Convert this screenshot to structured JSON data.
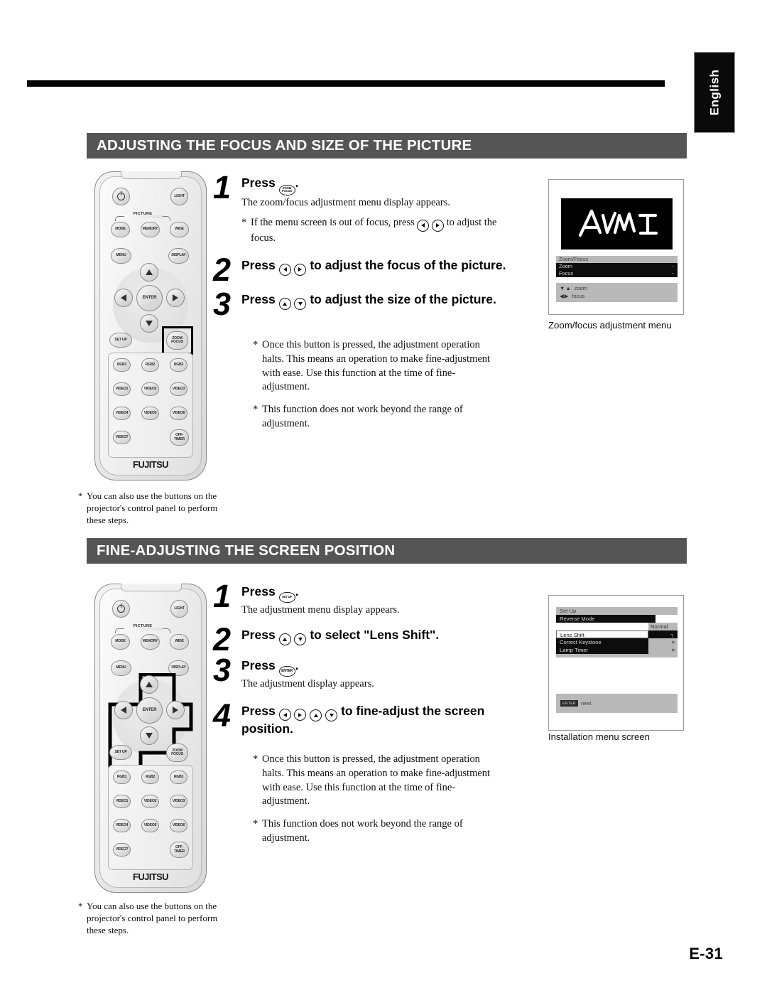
{
  "page": {
    "language_tab": "English",
    "page_number": "E-31"
  },
  "sections": [
    {
      "id": "focus-size",
      "title": "ADJUSTING THE FOCUS AND SIZE OF THE PICTURE",
      "steps": [
        {
          "num": "1",
          "head_before": "Press",
          "head_after": ".",
          "icon": "zoom-focus-key",
          "sub": "The zoom/focus adjustment menu display appears.",
          "note": "If the menu screen is out of focus, press ◀ ▶ to adjust the focus.",
          "note_before": "If the menu screen is out of focus, press",
          "note_after": "to adjust the focus."
        },
        {
          "num": "2",
          "head_before": "Press",
          "head_after": "to adjust the focus of the picture.",
          "icons": [
            "left-arrow-key",
            "right-arrow-key"
          ]
        },
        {
          "num": "3",
          "head_before": "Press",
          "head_after": "to adjust the size of the picture.",
          "icons": [
            "up-arrow-key",
            "down-arrow-key"
          ]
        }
      ],
      "notes": [
        "Once this button is pressed, the adjustment operation halts. This means an operation to make fine-adjustment with ease. Use this function at the time of fine-adjustment.",
        "This function does not work beyond the range of adjustment."
      ],
      "remote_note": "You can also use the buttons on the projector's control panel to perform these steps.",
      "osd_caption": "Zoom/focus adjustment menu"
    },
    {
      "id": "screen-position",
      "title": "FINE-ADJUSTING THE SCREEN POSITION",
      "steps": [
        {
          "num": "1",
          "head_before": "Press",
          "head_after": ".",
          "icon": "set-up-key",
          "sub": "The adjustment menu display appears."
        },
        {
          "num": "2",
          "head_before": "Press",
          "head_after": "to select \"Lens Shift\".",
          "icons": [
            "up-arrow-key",
            "down-arrow-key"
          ]
        },
        {
          "num": "3",
          "head_before": "Press",
          "head_after": ".",
          "icon": "enter-key",
          "sub": "The adjustment display appears."
        },
        {
          "num": "4",
          "head_before": "Press",
          "head_after": "to fine-adjust the screen position.",
          "icons": [
            "left-arrow-key",
            "right-arrow-key",
            "up-arrow-key",
            "down-arrow-key"
          ]
        }
      ],
      "notes": [
        "Once this button is pressed, the adjustment operation halts. This means an operation to make fine-adjustment with ease. Use this function at the time of fine-adjustment.",
        "This function does not work beyond the range of adjustment."
      ],
      "remote_note": "You can also use the buttons on the projector's control panel to perform these steps.",
      "osd_caption": "Installation menu screen"
    }
  ],
  "remote": {
    "brand": "FUJITSU",
    "picture_group_label": "PICTURE",
    "buttons": {
      "power": "power-icon",
      "light": "LIGHT",
      "mode": "MODE",
      "memory": "MEMORY",
      "wide": "WIDE",
      "menu": "MENU",
      "display": "DISPLAY",
      "enter": "ENTER",
      "set_up": "SET UP",
      "zoom_focus_line1": "ZOOM",
      "zoom_focus_line2": "FOCUS"
    },
    "keypad": [
      [
        "RGB1",
        "RGB2",
        "RGB3"
      ],
      [
        "VIDEO1",
        "VIDEO2",
        "VIDEO3"
      ],
      [
        "VIDEO4",
        "VIDEO5",
        "VIDEO6"
      ],
      [
        "VIDEO7",
        "OFF-TIMER"
      ]
    ],
    "off_timer_line1": "OFF-",
    "off_timer_line2": "TIMER",
    "highlight_1": "zoom-focus-button",
    "highlight_2": "direction-pad-and-set-up"
  },
  "osd_zoom_focus": {
    "logo": "AvM II",
    "title": "Zoom/Focus",
    "rows": [
      {
        "label": "Zoom",
        "value": "-"
      },
      {
        "label": "Focus",
        "value": "-"
      }
    ],
    "hints": [
      {
        "glyphs": "▼▲",
        "label": "zoom"
      },
      {
        "glyphs": "◀▶",
        "label": "focus"
      }
    ]
  },
  "osd_set_up": {
    "title": "Set Up",
    "rows": [
      {
        "label": "Reverse Mode",
        "value": "Normal"
      },
      {
        "label": "Lens Shift",
        "value": "┐"
      },
      {
        "label": "Correct Keystone",
        "value": "≡"
      },
      {
        "label": "Lamp Timer",
        "value": "≡"
      }
    ],
    "footer_key": "ENTER",
    "footer_label": "next"
  },
  "colors": {
    "section_bar": "#555555",
    "rule": "#000000",
    "tab_background": "#0a0a0a",
    "osd_dark_row": "#0d0d0d",
    "osd_gray_row": "#adadad"
  }
}
